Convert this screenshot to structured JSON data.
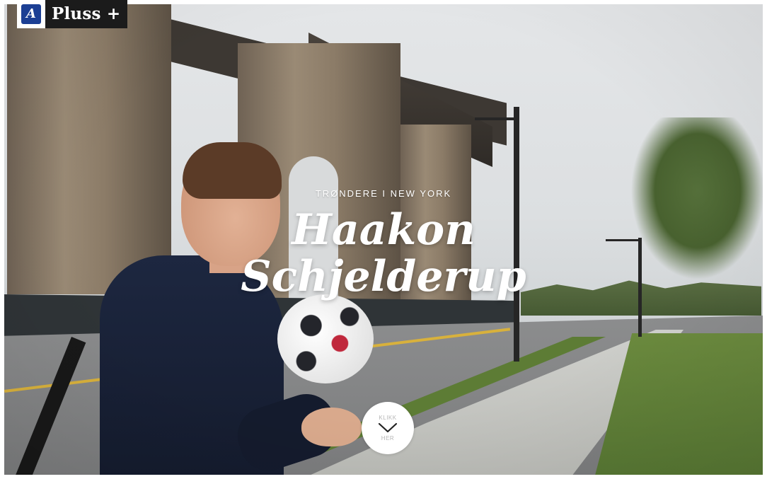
{
  "brand": {
    "logo_letter": "A",
    "name": "Pluss +"
  },
  "article": {
    "kicker": "TRØNDERE I NEW YORK",
    "title_line1": "Haakon",
    "title_line2": "Schjelderup"
  },
  "scroll_button": {
    "top_text": "KLIKK",
    "bottom_text": "HER",
    "icon": "chevron-down-icon"
  },
  "colors": {
    "logo_blue": "#1c3f94",
    "brand_bar": "#1b1b1b"
  }
}
